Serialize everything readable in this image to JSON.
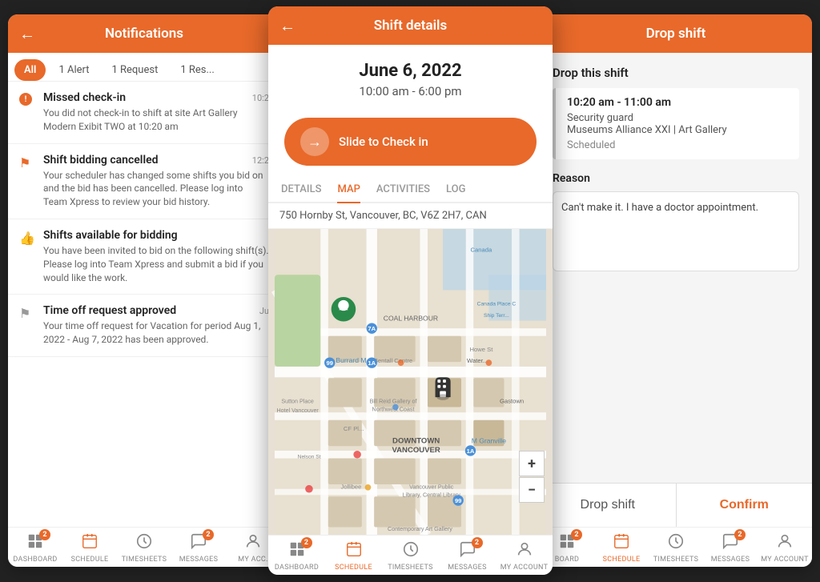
{
  "notifications": {
    "title": "Notifications",
    "back_icon": "←",
    "tabs": [
      {
        "label": "All",
        "active": true
      },
      {
        "label": "1 Alert"
      },
      {
        "label": "1 Request"
      },
      {
        "label": "1 Res..."
      }
    ],
    "items": [
      {
        "type": "alert",
        "title": "Missed check-in",
        "time": "10:2",
        "body": "You did not check-in to shift at site Art Gallery Modern Exibit TWO at 10:20 am"
      },
      {
        "type": "flag",
        "title": "Shift bidding cancelled",
        "time": "12:2",
        "body": "Your scheduler has changed some shifts you bid on and the bid has been cancelled. Please log into Team Xpress to review your bid history."
      },
      {
        "type": "hand",
        "title": "Shifts available for bidding",
        "time": "",
        "body": "You have been invited to bid on the following shift(s). Please log into Team Xpress and submit a bid if you would like the work."
      },
      {
        "type": "flag_gray",
        "title": "Time off request approved",
        "time": "Ju",
        "body": "Your time off request for Vacation for period Aug 1, 2022 - Aug 7, 2022 has been approved."
      }
    ],
    "nav": [
      {
        "label": "DASHBOARD",
        "icon": "⊞",
        "badge": 2
      },
      {
        "label": "SCHEDULE",
        "icon": "📅",
        "badge": 0,
        "active": false
      },
      {
        "label": "TIMESHEETS",
        "icon": "🕐",
        "badge": 0
      },
      {
        "label": "MESSAGES",
        "icon": "💬",
        "badge": 2
      },
      {
        "label": "MY ACC.",
        "icon": "👤",
        "badge": 0
      }
    ]
  },
  "shift_details": {
    "title": "Shift details",
    "back_icon": "←",
    "date": "June 6, 2022",
    "time_range": "10:00 am - 6:00 pm",
    "checkin_label": "Slide to Check in",
    "tabs": [
      {
        "label": "DETAILS"
      },
      {
        "label": "MAP",
        "active": true
      },
      {
        "label": "ACTIVITIES"
      },
      {
        "label": "LOG"
      }
    ],
    "address": "750 Hornby St, Vancouver, BC, V6Z 2H7, CAN",
    "map_zoom_in": "+",
    "map_zoom_out": "−",
    "nav": [
      {
        "label": "DASHBOARD",
        "icon": "⊞",
        "badge": 2
      },
      {
        "label": "SCHEDULE",
        "icon": "📅",
        "badge": 0,
        "active": true
      },
      {
        "label": "TIMESHEETS",
        "icon": "🕐",
        "badge": 0
      },
      {
        "label": "MESSAGES",
        "icon": "💬",
        "badge": 2
      },
      {
        "label": "MY ACCOUNT",
        "icon": "👤",
        "badge": 0
      }
    ]
  },
  "drop_shift": {
    "title": "Drop shift",
    "section_title": "Drop this shift",
    "shift_time": "10:20 am - 11:00 am",
    "shift_role": "Security guard",
    "shift_org": "Museums Alliance XXI | Art Gallery",
    "shift_status": "Scheduled",
    "reason_label": "Reason",
    "reason_placeholder": "Can't make it. I have a doctor appointment.",
    "btn_drop": "Drop shift",
    "btn_confirm": "Confirm",
    "nav": [
      {
        "label": "BOARD",
        "icon": "⊞",
        "badge": 2
      },
      {
        "label": "SCHEDULE",
        "icon": "📅",
        "badge": 0,
        "active": true
      },
      {
        "label": "TIMESHEETS",
        "icon": "🕐",
        "badge": 0
      },
      {
        "label": "MESSAGES",
        "icon": "💬",
        "badge": 2
      },
      {
        "label": "MY ACCOUNT",
        "icon": "👤",
        "badge": 0
      }
    ]
  }
}
